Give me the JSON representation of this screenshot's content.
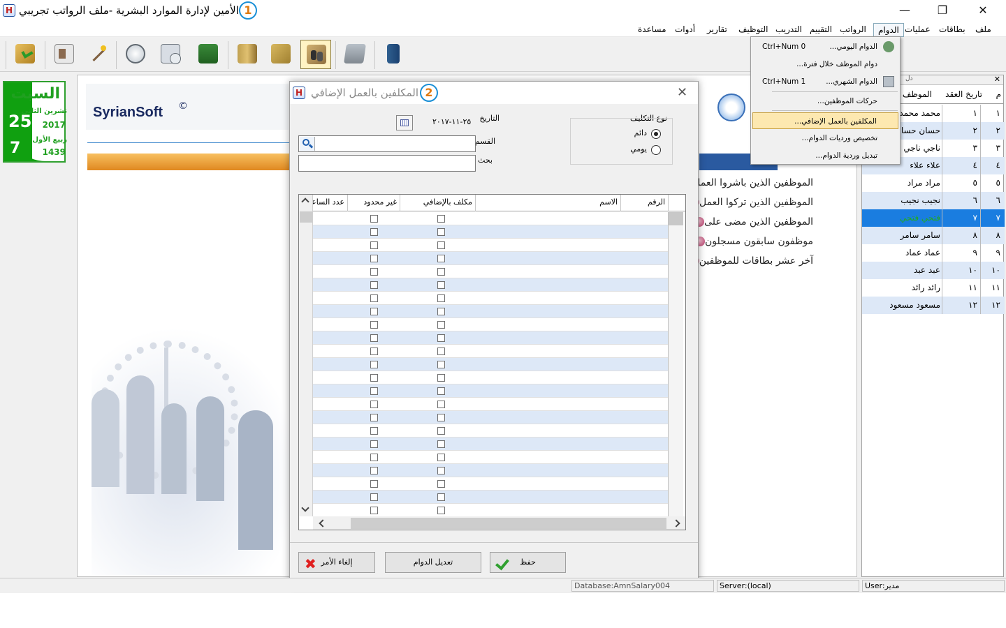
{
  "app": {
    "icon_glyph": "H",
    "title": "الأمين لإدارة الموارد البشرية -ملف الرواتب تجريبي",
    "badge": "1",
    "controls": {
      "minimize": "—",
      "maximize": "❐",
      "close": "✕"
    }
  },
  "menubar": {
    "items": [
      "ملف",
      "بطاقات",
      "عمليات",
      "الدوام",
      "الرواتب",
      "التقييم",
      "التدريب",
      "التوظيف",
      "تقارير",
      "أدوات",
      "مساعدة"
    ],
    "active": "الدوام"
  },
  "toolbar": {
    "buttons": [
      "open-folder-icon",
      "employee-card-icon",
      "magic-wand-icon",
      "clock-icon",
      "monthly-calendar-icon",
      "money-stack-icon",
      "books-icon",
      "folders-icon",
      "employees-group-icon",
      "calculator-icon",
      "exit-door-icon"
    ],
    "pressed": "employees-group-icon"
  },
  "calendar_widget": {
    "day_name": "السبت",
    "greg_day": "25",
    "greg_month": "تشرين الثاني",
    "greg_year": "2017",
    "hijri_day": "7",
    "hijri_month": "ربيع الأول",
    "hijri_year": "1439"
  },
  "brand": {
    "name": "SyrianSoft",
    "mark": "©"
  },
  "home_links": [
    "الموظفين الذين باشروا العمل",
    "الموظفين الذين تركوا العمل",
    "الموظفين الذين مضى على",
    "موظفون سابقون مسجلون",
    "آخر عشر بطاقات للموظفين"
  ],
  "dropdown": {
    "items": [
      {
        "label": "الدوام اليومي...",
        "shortcut": "Ctrl+Num 0",
        "icon": "daily-attendance-icon"
      },
      {
        "label": "دوام الموظف خلال فترة...",
        "shortcut": "",
        "icon": ""
      },
      {
        "label": "الدوام الشهري...",
        "shortcut": "Ctrl+Num 1",
        "icon": "monthly-attendance-icon"
      },
      {
        "label": "حركات الموظفين...",
        "shortcut": "",
        "icon": ""
      },
      {
        "label": "المكلفين بالعمل الإضافي...",
        "shortcut": "",
        "icon": "",
        "highlighted": true
      },
      {
        "label": "تخصيص ورديات الدوام...",
        "shortcut": "",
        "icon": ""
      },
      {
        "label": "تبديل وردية الدوام...",
        "shortcut": "",
        "icon": ""
      }
    ]
  },
  "dialog": {
    "title": "المكلفين بالعمل الإضافي",
    "badge": "2",
    "close": "✕",
    "assignment_type": {
      "label": "نوع التكليف",
      "options": [
        "دائم",
        "يومي"
      ],
      "selected": "دائم"
    },
    "date_label": "التاريخ",
    "date_value": "٢٥-١١-٢٠١٧",
    "department_label": "القسم",
    "search_label": "بحث",
    "grid": {
      "columns": [
        "الرقم",
        "الاسم",
        "مكلف بالإضافي",
        "غير محدود",
        "عدد الساعات"
      ],
      "row_count": 23
    },
    "buttons": {
      "save": "حفظ",
      "edit_attendance": "تعديل الدوام",
      "cancel": "إلغاء الأمر"
    }
  },
  "right_panel": {
    "close": "✕",
    "header_partial": "دل",
    "columns": [
      "م",
      "تاريخ العقد",
      "الموظف"
    ],
    "rows": [
      {
        "n": "١",
        "contract": "١",
        "name": "محمد محمد"
      },
      {
        "n": "٢",
        "contract": "٢",
        "name": "حسان حسان"
      },
      {
        "n": "٣",
        "contract": "٣",
        "name": "ناجي ناجي"
      },
      {
        "n": "٤",
        "contract": "٤",
        "name": "علاء علاء"
      },
      {
        "n": "٥",
        "contract": "٥",
        "name": "مراد مراد"
      },
      {
        "n": "٦",
        "contract": "٦",
        "name": "نجيب نجيب"
      },
      {
        "n": "٧",
        "contract": "٧",
        "name": "فتحي فتحي",
        "selected": true
      },
      {
        "n": "٨",
        "contract": "٨",
        "name": "سامر سامر"
      },
      {
        "n": "٩",
        "contract": "٩",
        "name": "عماد عماد"
      },
      {
        "n": "١٠",
        "contract": "١٠",
        "name": "عبد عبد"
      },
      {
        "n": "١١",
        "contract": "١١",
        "name": "رائد رائد"
      },
      {
        "n": "١٢",
        "contract": "١٢",
        "name": "مسعود مسعود"
      }
    ]
  },
  "statusbar": {
    "database": "Database:AmnSalary004",
    "server": "Server:(local)",
    "user": "User:مدير"
  },
  "colors": {
    "accent_blue": "#1a7de0",
    "row_alt": "#dde8f7",
    "calendar_green": "#10a010",
    "highlight": "#fde8b0"
  }
}
